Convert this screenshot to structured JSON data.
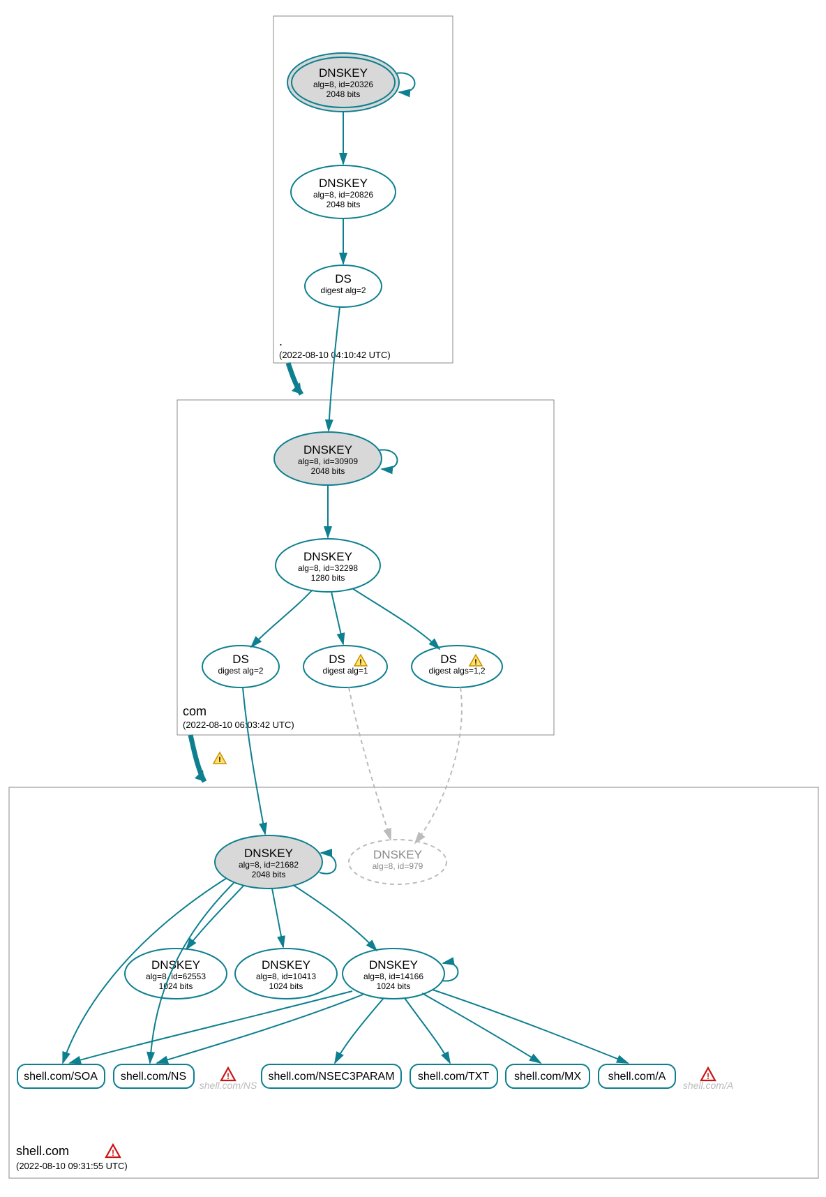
{
  "zones": {
    "root": {
      "label": ".",
      "timestamp": "(2022-08-10 04:10:42 UTC)"
    },
    "com": {
      "label": "com",
      "timestamp": "(2022-08-10 06:03:42 UTC)"
    },
    "shell": {
      "label": "shell.com",
      "timestamp": "(2022-08-10 09:31:55 UTC)"
    }
  },
  "nodes": {
    "root_ksk": {
      "title": "DNSKEY",
      "line1": "alg=8, id=20326",
      "line2": "2048 bits"
    },
    "root_zsk": {
      "title": "DNSKEY",
      "line1": "alg=8, id=20826",
      "line2": "2048 bits"
    },
    "root_ds": {
      "title": "DS",
      "line1": "digest alg=2"
    },
    "com_ksk": {
      "title": "DNSKEY",
      "line1": "alg=8, id=30909",
      "line2": "2048 bits"
    },
    "com_zsk": {
      "title": "DNSKEY",
      "line1": "alg=8, id=32298",
      "line2": "1280 bits"
    },
    "com_ds1": {
      "title": "DS",
      "line1": "digest alg=2"
    },
    "com_ds2": {
      "title": "DS",
      "line1": "digest alg=1"
    },
    "com_ds3": {
      "title": "DS",
      "line1": "digest algs=1,2"
    },
    "shell_ksk": {
      "title": "DNSKEY",
      "line1": "alg=8, id=21682",
      "line2": "2048 bits"
    },
    "shell_ghost": {
      "title": "DNSKEY",
      "line1": "alg=8, id=979"
    },
    "shell_k1": {
      "title": "DNSKEY",
      "line1": "alg=8, id=62553",
      "line2": "1024 bits"
    },
    "shell_k2": {
      "title": "DNSKEY",
      "line1": "alg=8, id=10413",
      "line2": "1024 bits"
    },
    "shell_k3": {
      "title": "DNSKEY",
      "line1": "alg=8, id=14166",
      "line2": "1024 bits"
    }
  },
  "rr": {
    "soa": "shell.com/SOA",
    "ns": "shell.com/NS",
    "ns_g": "shell.com/NS",
    "n3p": "shell.com/NSEC3PARAM",
    "txt": "shell.com/TXT",
    "mx": "shell.com/MX",
    "a": "shell.com/A",
    "a_g": "shell.com/A"
  }
}
